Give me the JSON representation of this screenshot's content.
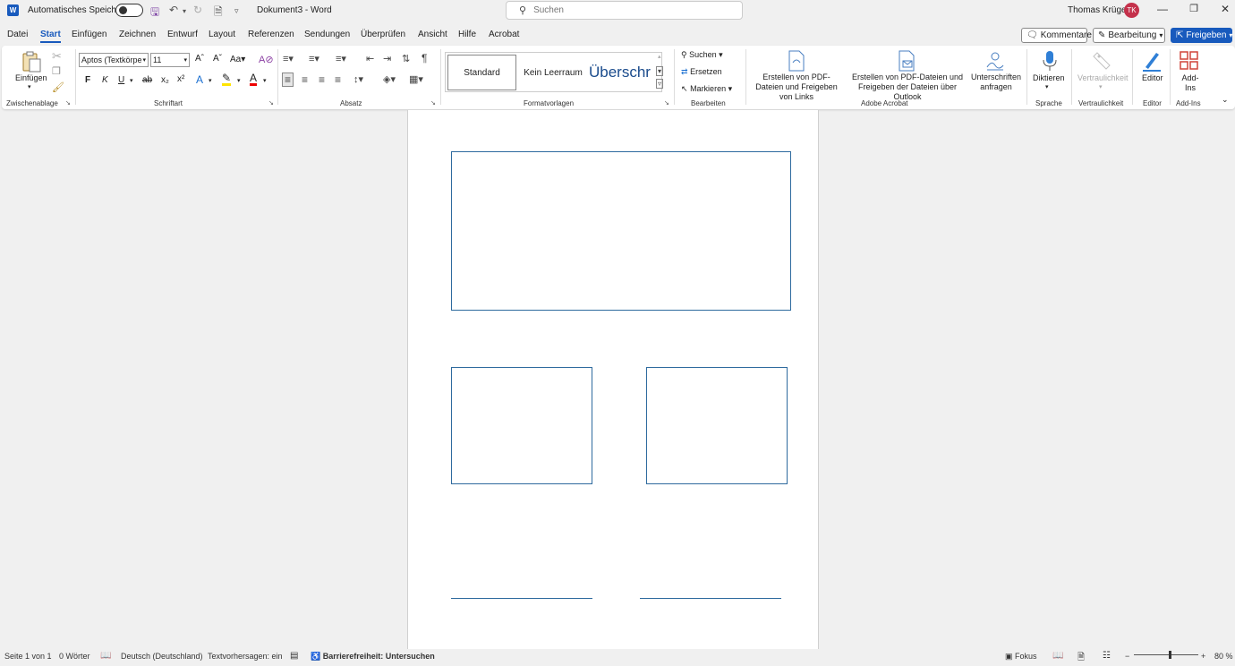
{
  "titlebar": {
    "autosave_label": "Automatisches Speichern",
    "doc_title": "Dokument3 - Word",
    "search_placeholder": "Suchen",
    "user_name": "Thomas Krüger",
    "user_initials": "TK",
    "avatar_color": "#c4314b"
  },
  "menu": {
    "items": [
      "Datei",
      "Start",
      "Einfügen",
      "Zeichnen",
      "Entwurf",
      "Layout",
      "Referenzen",
      "Sendungen",
      "Überprüfen",
      "Ansicht",
      "Hilfe",
      "Acrobat"
    ],
    "active": "Start",
    "comments_label": "Kommentare",
    "editing_label": "Bearbeitung",
    "share_label": "Freigeben"
  },
  "ribbon": {
    "clipboard": {
      "paste_label": "Einfügen",
      "group_label": "Zwischenablage"
    },
    "font": {
      "font_name": "Aptos (Textkörpe",
      "font_size": "11",
      "group_label": "Schriftart",
      "bold": "F",
      "italic": "K",
      "underline": "U"
    },
    "paragraph": {
      "group_label": "Absatz"
    },
    "styles": {
      "tiles": [
        "Standard",
        "Kein Leerraum",
        "Überschr"
      ],
      "group_label": "Formatvorlagen"
    },
    "editing": {
      "find_label": "Suchen",
      "replace_label": "Ersetzen",
      "select_label": "Markieren",
      "group_label": "Bearbeiten"
    },
    "acrobat": {
      "create_pdf_share_links": "Erstellen von PDF-Dateien und Freigeben von Links",
      "create_pdf_share_outlook": "Erstellen von PDF-Dateien und Freigeben der Dateien über Outlook",
      "request_signatures": "Unterschriften anfragen",
      "group_label": "Adobe Acrobat"
    },
    "voice": {
      "dictate_label": "Diktieren",
      "group_label": "Sprache"
    },
    "sensitivity": {
      "label": "Vertraulichkeit",
      "group_label": "Vertraulichkeit"
    },
    "editor": {
      "label": "Editor",
      "group_label": "Editor"
    },
    "addins": {
      "label": "Add-Ins",
      "group_label": "Add-Ins"
    }
  },
  "statusbar": {
    "page": "Seite 1 von 1",
    "words": "0 Wörter",
    "language": "Deutsch (Deutschland)",
    "predictions": "Textvorhersagen: ein",
    "accessibility": "Barrierefreiheit: Untersuchen",
    "focus": "Fokus",
    "zoom": "80 %",
    "zoom_level": 0.55
  },
  "colors": {
    "accent": "#185abd",
    "frame_border": "#2e6a9e"
  }
}
